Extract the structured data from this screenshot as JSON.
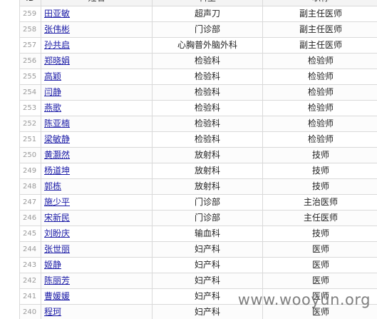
{
  "table": {
    "headers": {
      "id": "ID",
      "name": "姓名",
      "dept": "科室",
      "title": "职称"
    },
    "rows": [
      {
        "id": "259",
        "name": "田亚敏",
        "dept": "超声刀",
        "title": "副主任医师"
      },
      {
        "id": "258",
        "name": "张伟彬",
        "dept": "门诊部",
        "title": "副主任医师"
      },
      {
        "id": "257",
        "name": "孙共启",
        "dept": "心胸普外脑外科",
        "title": "副主任医师"
      },
      {
        "id": "256",
        "name": "郑晓娟",
        "dept": "检验科",
        "title": "检验师"
      },
      {
        "id": "255",
        "name": "高颖",
        "dept": "检验科",
        "title": "检验师"
      },
      {
        "id": "254",
        "name": "闫静",
        "dept": "检验科",
        "title": "检验师"
      },
      {
        "id": "253",
        "name": "燕歌",
        "dept": "检验科",
        "title": "检验师"
      },
      {
        "id": "252",
        "name": "陈亚楠",
        "dept": "检验科",
        "title": "检验师"
      },
      {
        "id": "251",
        "name": "梁敏静",
        "dept": "检验科",
        "title": "检验师"
      },
      {
        "id": "250",
        "name": "黄灏然",
        "dept": "放射科",
        "title": "技师"
      },
      {
        "id": "249",
        "name": "杨道坤",
        "dept": "放射科",
        "title": "技师"
      },
      {
        "id": "248",
        "name": "郭栋",
        "dept": "放射科",
        "title": "技师"
      },
      {
        "id": "247",
        "name": "施少平",
        "dept": "门诊部",
        "title": "主治医师"
      },
      {
        "id": "246",
        "name": "宋新民",
        "dept": "门诊部",
        "title": "主任医师"
      },
      {
        "id": "245",
        "name": "刘盼庆",
        "dept": "输血科",
        "title": "技师"
      },
      {
        "id": "244",
        "name": "张世丽",
        "dept": "妇产科",
        "title": "医师"
      },
      {
        "id": "243",
        "name": "姬静",
        "dept": "妇产科",
        "title": "医师"
      },
      {
        "id": "242",
        "name": "陈丽芳",
        "dept": "妇产科",
        "title": "医师"
      },
      {
        "id": "241",
        "name": "曹媛媛",
        "dept": "妇产科",
        "title": "医师"
      },
      {
        "id": "240",
        "name": "程珂",
        "dept": "妇产科",
        "title": "医师"
      }
    ]
  },
  "watermark": "www.wooyun.org"
}
